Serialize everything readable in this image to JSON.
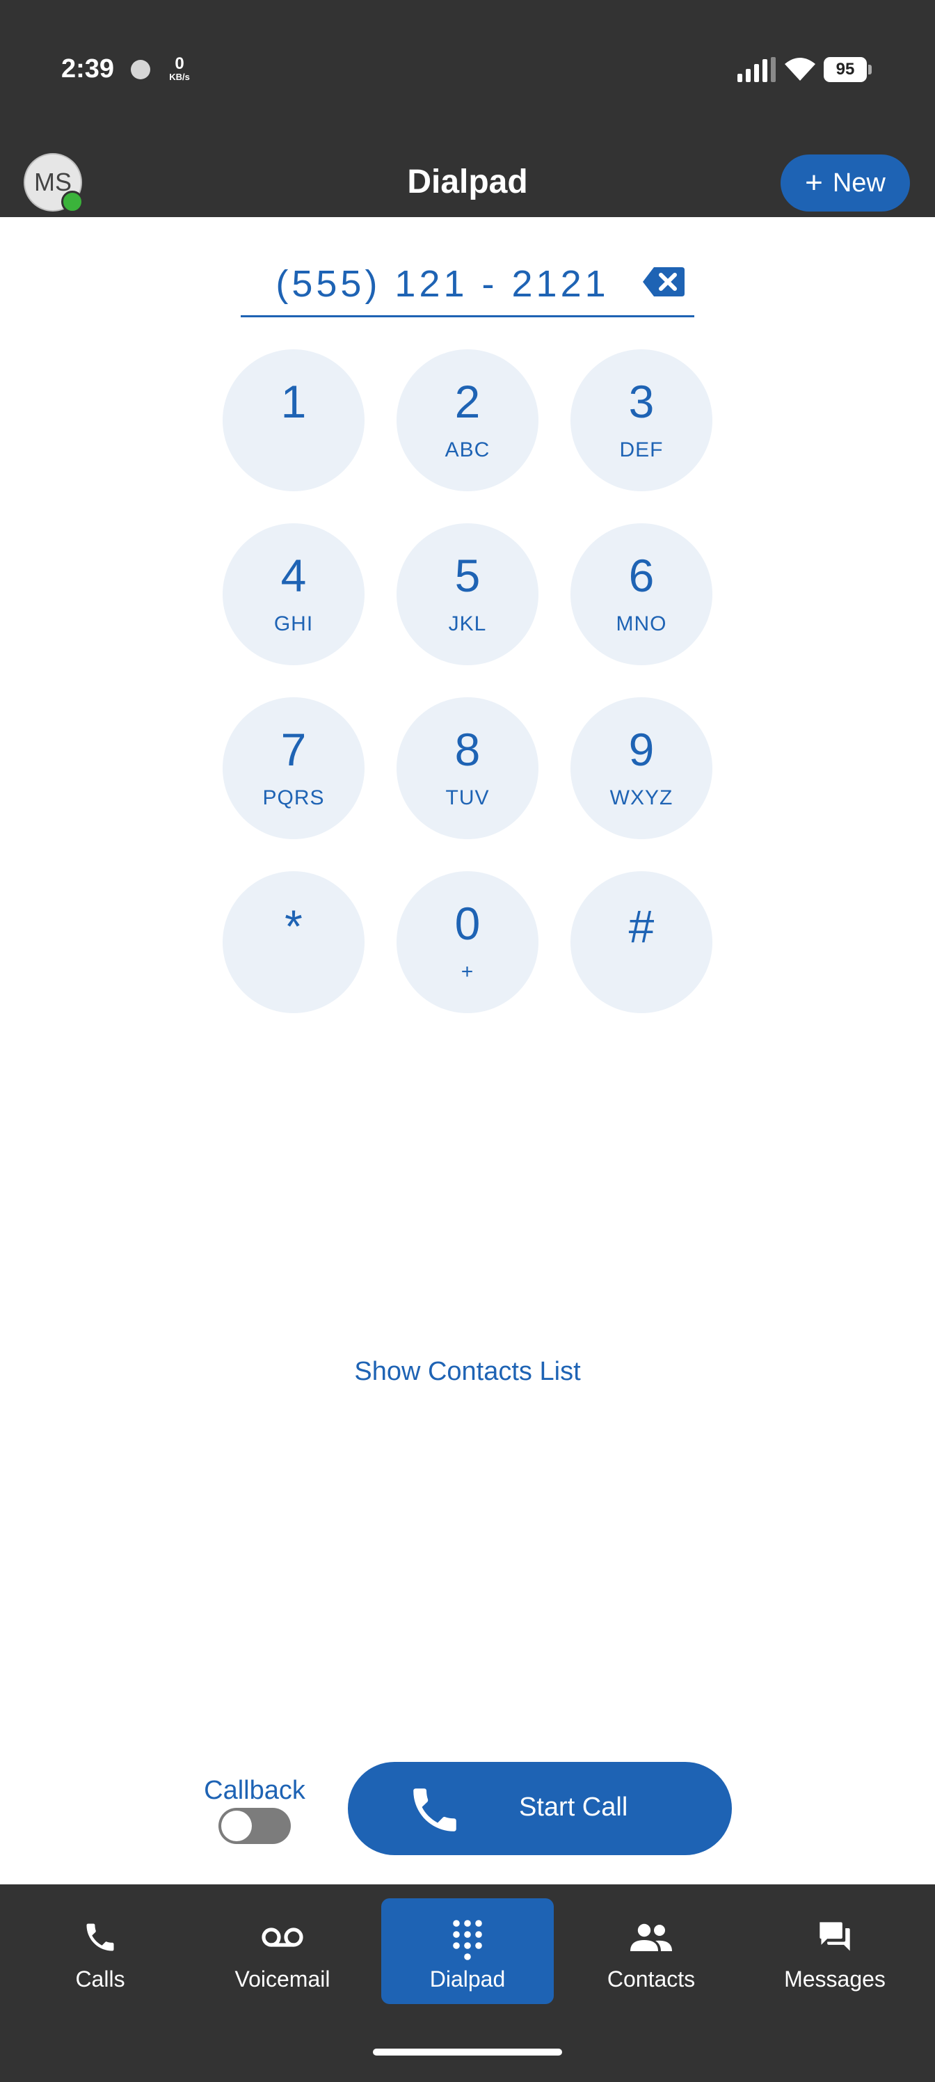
{
  "status_bar": {
    "time": "2:39",
    "net_speed_value": "0",
    "net_speed_unit": "KB/s",
    "battery": "95",
    "icons": [
      "recording-dot-icon",
      "signal-icon",
      "wifi-icon",
      "battery-icon"
    ]
  },
  "header": {
    "avatar_initials": "MS",
    "presence_status_color": "#3bb33b",
    "title": "Dialpad",
    "new_button_label": "New",
    "new_button_icon": "plus-icon"
  },
  "dialer": {
    "number": "(555) 121 - 2121",
    "backspace_icon": "backspace-icon"
  },
  "keypad": [
    {
      "digit": "1",
      "letters": ""
    },
    {
      "digit": "2",
      "letters": "ABC"
    },
    {
      "digit": "3",
      "letters": "DEF"
    },
    {
      "digit": "4",
      "letters": "GHI"
    },
    {
      "digit": "5",
      "letters": "JKL"
    },
    {
      "digit": "6",
      "letters": "MNO"
    },
    {
      "digit": "7",
      "letters": "PQRS"
    },
    {
      "digit": "8",
      "letters": "TUV"
    },
    {
      "digit": "9",
      "letters": "WXYZ"
    },
    {
      "digit": "*",
      "letters": ""
    },
    {
      "digit": "0",
      "letters": "+"
    },
    {
      "digit": "#",
      "letters": ""
    }
  ],
  "show_contacts_label": "Show Contacts List",
  "call_controls": {
    "callback_label": "Callback",
    "callback_enabled": false,
    "start_call_label": "Start Call",
    "start_call_icon": "phone-icon"
  },
  "bottom_nav": [
    {
      "label": "Calls",
      "icon": "phone-icon",
      "active": false
    },
    {
      "label": "Voicemail",
      "icon": "voicemail-icon",
      "active": false
    },
    {
      "label": "Dialpad",
      "icon": "dialpad-icon",
      "active": true
    },
    {
      "label": "Contacts",
      "icon": "contacts-icon",
      "active": false
    },
    {
      "label": "Messages",
      "icon": "messages-icon",
      "active": false
    }
  ],
  "colors": {
    "accent": "#1e63b4",
    "bar_background": "#333333",
    "key_background": "#ebf1f8",
    "toggle_off": "#7c7c7c"
  }
}
